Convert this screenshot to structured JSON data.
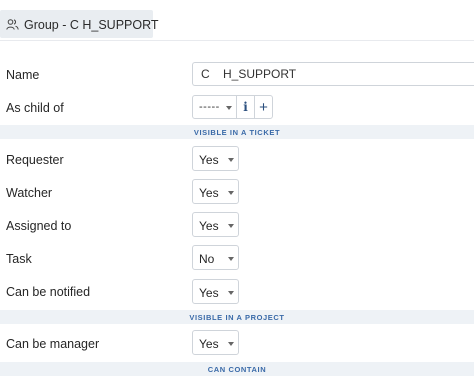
{
  "header": {
    "title": "Group - C    H_SUPPORT",
    "icon": "users-icon"
  },
  "fields": {
    "name_label": "Name",
    "name_value": "C    H_SUPPORT",
    "child_label": "As child of",
    "child_value": "-----",
    "info_label": "i",
    "plus_label": "+"
  },
  "sections": {
    "ticket": "VISIBLE IN A TICKET",
    "project": "VISIBLE IN A PROJECT",
    "contain": "CAN CONTAIN"
  },
  "ticket_rows": [
    {
      "label": "Requester",
      "value": "Yes"
    },
    {
      "label": "Watcher",
      "value": "Yes"
    },
    {
      "label": "Assigned to",
      "value": "Yes"
    },
    {
      "label": "Task",
      "value": "No"
    },
    {
      "label": "Can be notified",
      "value": "Yes"
    }
  ],
  "project_rows": [
    {
      "label": "Can be manager",
      "value": "Yes"
    }
  ]
}
